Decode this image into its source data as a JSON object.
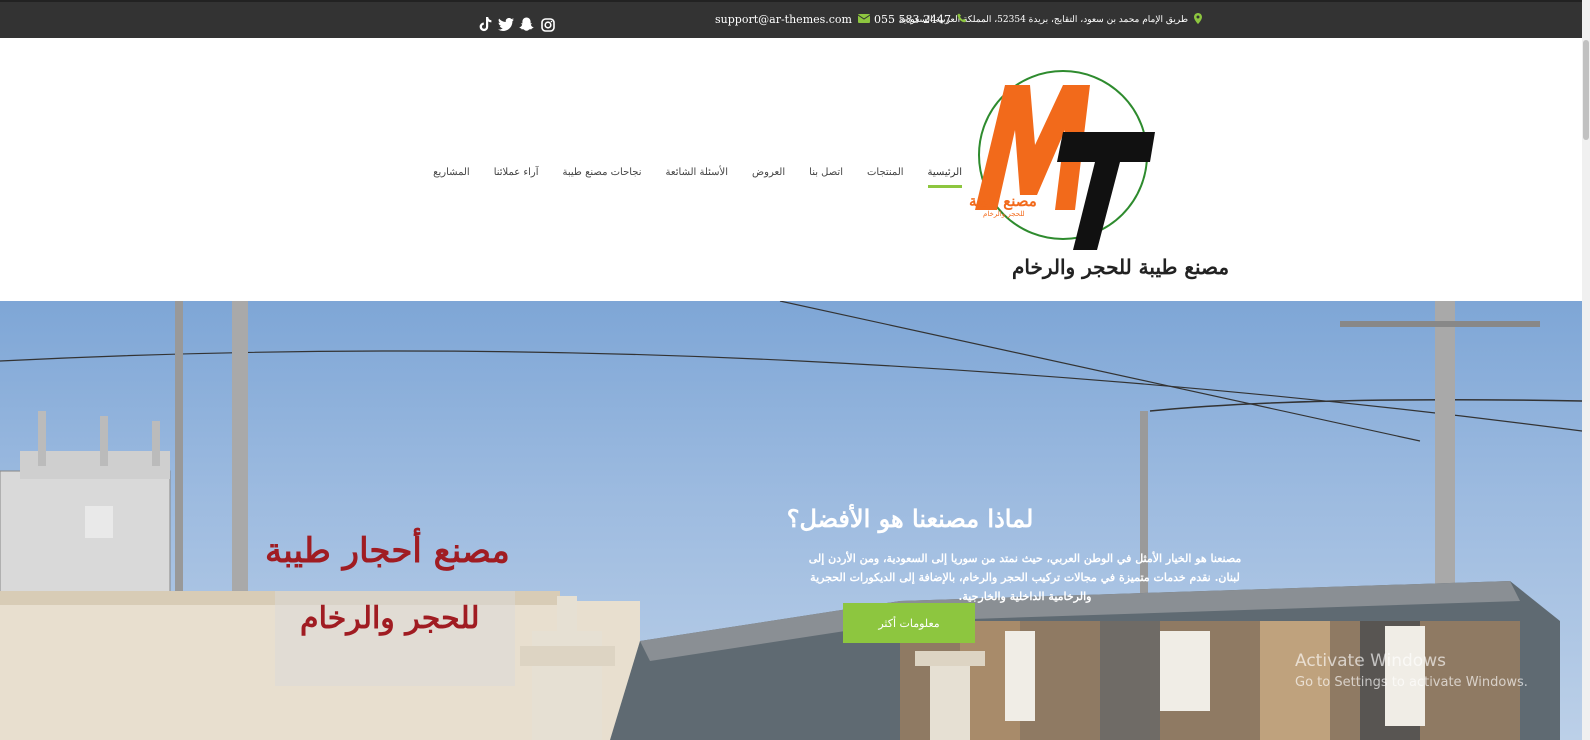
{
  "topbar": {
    "address": "طريق الإمام محمد بن سعود، التقايج، بريدة 52354، المملكة العربية السعودية",
    "phone": "055 583 2447",
    "email": "support@ar-themes.com",
    "icons": [
      "map-marker-icon",
      "phone-icon",
      "envelope-icon",
      "instagram-icon",
      "snapchat-icon",
      "twitter-icon",
      "tiktok-icon"
    ]
  },
  "logo": {
    "letters": "MT",
    "sub_ar": "مصنع طيبة",
    "sub_small": "للحجر والرخام",
    "caption": "مصنع طيبة للحجر والرخام",
    "colors": {
      "orange": "#f26a1b",
      "black": "#111111",
      "green": "#2e8b2e"
    }
  },
  "nav": {
    "items": [
      {
        "label": "الرئيسية",
        "active": true
      },
      {
        "label": "المنتجات"
      },
      {
        "label": "اتصل بنا"
      },
      {
        "label": "العروض"
      },
      {
        "label": "الأسئلة الشائعة"
      },
      {
        "label": "نجاحات مصنع طيبة"
      },
      {
        "label": "آراء عملائنا"
      },
      {
        "label": "المشاريع"
      }
    ]
  },
  "hero": {
    "title": "لماذا مصنعنا هو الأفضل؟",
    "text": "مصنعنا هو الخيار الأمثل في الوطن العربي، حيث نمتد من سوريا إلى السعودية، ومن الأردن إلى لبنان. نقدم خدمات متميزة في مجالات تركيب الحجر والرخام، بالإضافة إلى الديكورات الحجرية والرخامية الداخلية والخارجية.",
    "button": "معلومات أكثر",
    "sign_line1": "مصنع أحجار طيبة",
    "sign_line2": "للحجر والرخام"
  },
  "watermark": {
    "line1": "Activate Windows",
    "line2": "Go to Settings to activate Windows."
  },
  "colors": {
    "accent": "#8dc63f",
    "topbar": "#333333",
    "sign": "#a01c22"
  }
}
